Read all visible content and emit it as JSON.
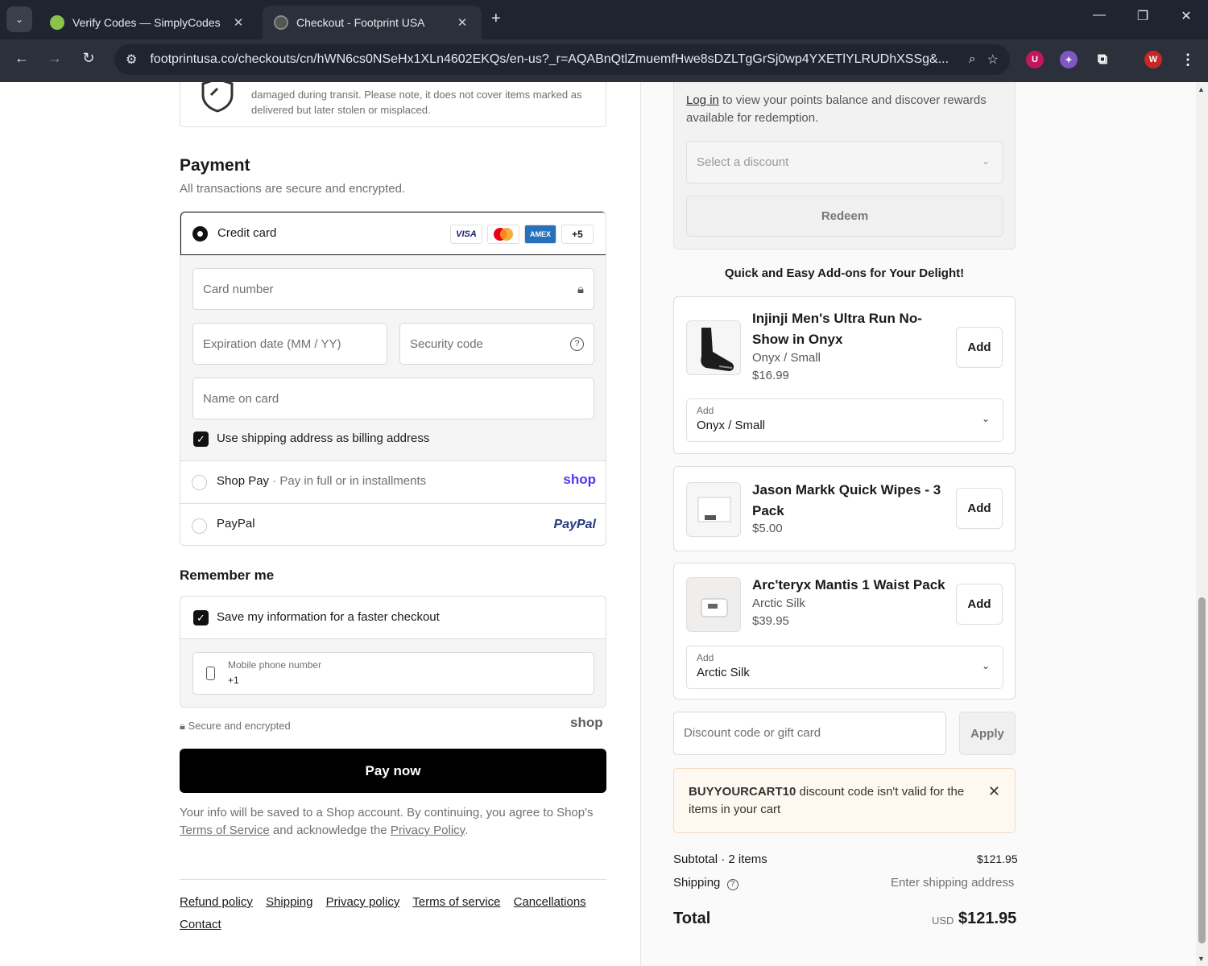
{
  "browser": {
    "tabs": [
      {
        "title": "Verify Codes — SimplyCodes",
        "active": false
      },
      {
        "title": "Checkout - Footprint USA",
        "active": true
      }
    ],
    "url": "footprintusa.co/checkouts/cn/hWN6cs0NSeHx1XLn4602EKQs/en-us?_r=AQABnQtlZmuemfHwe8sDZLTgGrSj0wp4YXETlYLRUDhXSSg&...",
    "profile_initial": "W",
    "ext_badge": "U"
  },
  "insurance": {
    "text": "damaged during transit. Please note, it does not cover items marked as delivered but later stolen or misplaced."
  },
  "payment": {
    "title": "Payment",
    "subtitle": "All transactions are secure and encrypted.",
    "credit_card_label": "Credit card",
    "card_logos": [
      "VISA",
      "AMEX",
      "+5"
    ],
    "card_number_placeholder": "Card number",
    "expiration_placeholder": "Expiration date (MM / YY)",
    "security_placeholder": "Security code",
    "name_placeholder": "Name on card",
    "billing_checkbox_label": "Use shipping address as billing address",
    "shop_pay_label": "Shop Pay",
    "shop_pay_sub": "Pay in full or in installments",
    "shop_logo": "shop",
    "paypal_label": "PayPal",
    "paypal_logo": "PayPal"
  },
  "remember": {
    "title": "Remember me",
    "save_label": "Save my information for a faster checkout",
    "phone_label": "Mobile phone number",
    "phone_value": "+1",
    "secure_note": "Secure and encrypted",
    "shop_logo": "shop"
  },
  "pay_button": "Pay now",
  "legal": {
    "line1": "Your info will be saved to a Shop account. By continuing, you agree to Shop's",
    "tos": "Terms of Service",
    "and": "and acknowledge the",
    "privacy": "Privacy Policy",
    "end": "."
  },
  "footer_links": [
    "Refund policy",
    "Shipping",
    "Privacy policy",
    "Terms of service",
    "Cancellations",
    "Contact"
  ],
  "rewards": {
    "login_link": "Log in",
    "login_text": "to view your points balance and discover rewards available for redemption.",
    "select_placeholder": "Select a discount",
    "redeem_label": "Redeem"
  },
  "addons": {
    "title": "Quick and Easy Add-ons for Your Delight!",
    "items": [
      {
        "name": "Injinji Men's Ultra Run No-Show in Onyx",
        "variant": "Onyx / Small",
        "price": "$16.99",
        "add": "Add",
        "select_label": "Add",
        "select_value": "Onyx / Small"
      },
      {
        "name": "Jason Markk Quick Wipes - 3 Pack",
        "price": "$5.00",
        "add": "Add"
      },
      {
        "name": "Arc'teryx Mantis 1 Waist Pack",
        "variant": "Arctic Silk",
        "price": "$39.95",
        "add": "Add",
        "select_label": "Add",
        "select_value": "Arctic Silk"
      }
    ]
  },
  "discount": {
    "placeholder": "Discount code or gift card",
    "apply_label": "Apply",
    "error_code": "BUYYOURCART10",
    "error_text": "discount code isn't valid for the items in your cart"
  },
  "summary": {
    "subtotal_label": "Subtotal · 2 items",
    "subtotal_value": "$121.95",
    "shipping_label": "Shipping",
    "shipping_value": "Enter shipping address",
    "total_label": "Total",
    "currency": "USD",
    "total_value": "$121.95"
  },
  "colors": {
    "accent": "#5a31f4",
    "paypal": "#253b80",
    "error_bg": "#fff8f0"
  }
}
